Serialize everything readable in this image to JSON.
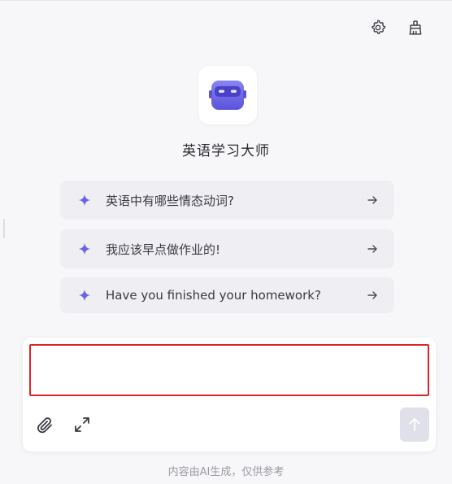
{
  "header": {
    "settings_icon": "gear-icon",
    "clear_icon": "broom-icon"
  },
  "bot": {
    "name": "英语学习大师",
    "avatar_icon": "robot-icon",
    "accent_color": "#6b62e8"
  },
  "suggestions": [
    {
      "text": "英语中有哪些情态动词?",
      "icon": "sparkle-icon"
    },
    {
      "text": "我应该早点做作业的!",
      "icon": "sparkle-icon"
    },
    {
      "text": "Have you finished your homework?",
      "icon": "sparkle-icon"
    }
  ],
  "composer": {
    "placeholder": "",
    "value": "",
    "attach_icon": "paperclip-icon",
    "expand_icon": "expand-icon",
    "send_icon": "arrow-up-icon",
    "highlight_color": "#d9262b"
  },
  "footer": {
    "disclaimer": "内容由AI生成，仅供参考"
  }
}
